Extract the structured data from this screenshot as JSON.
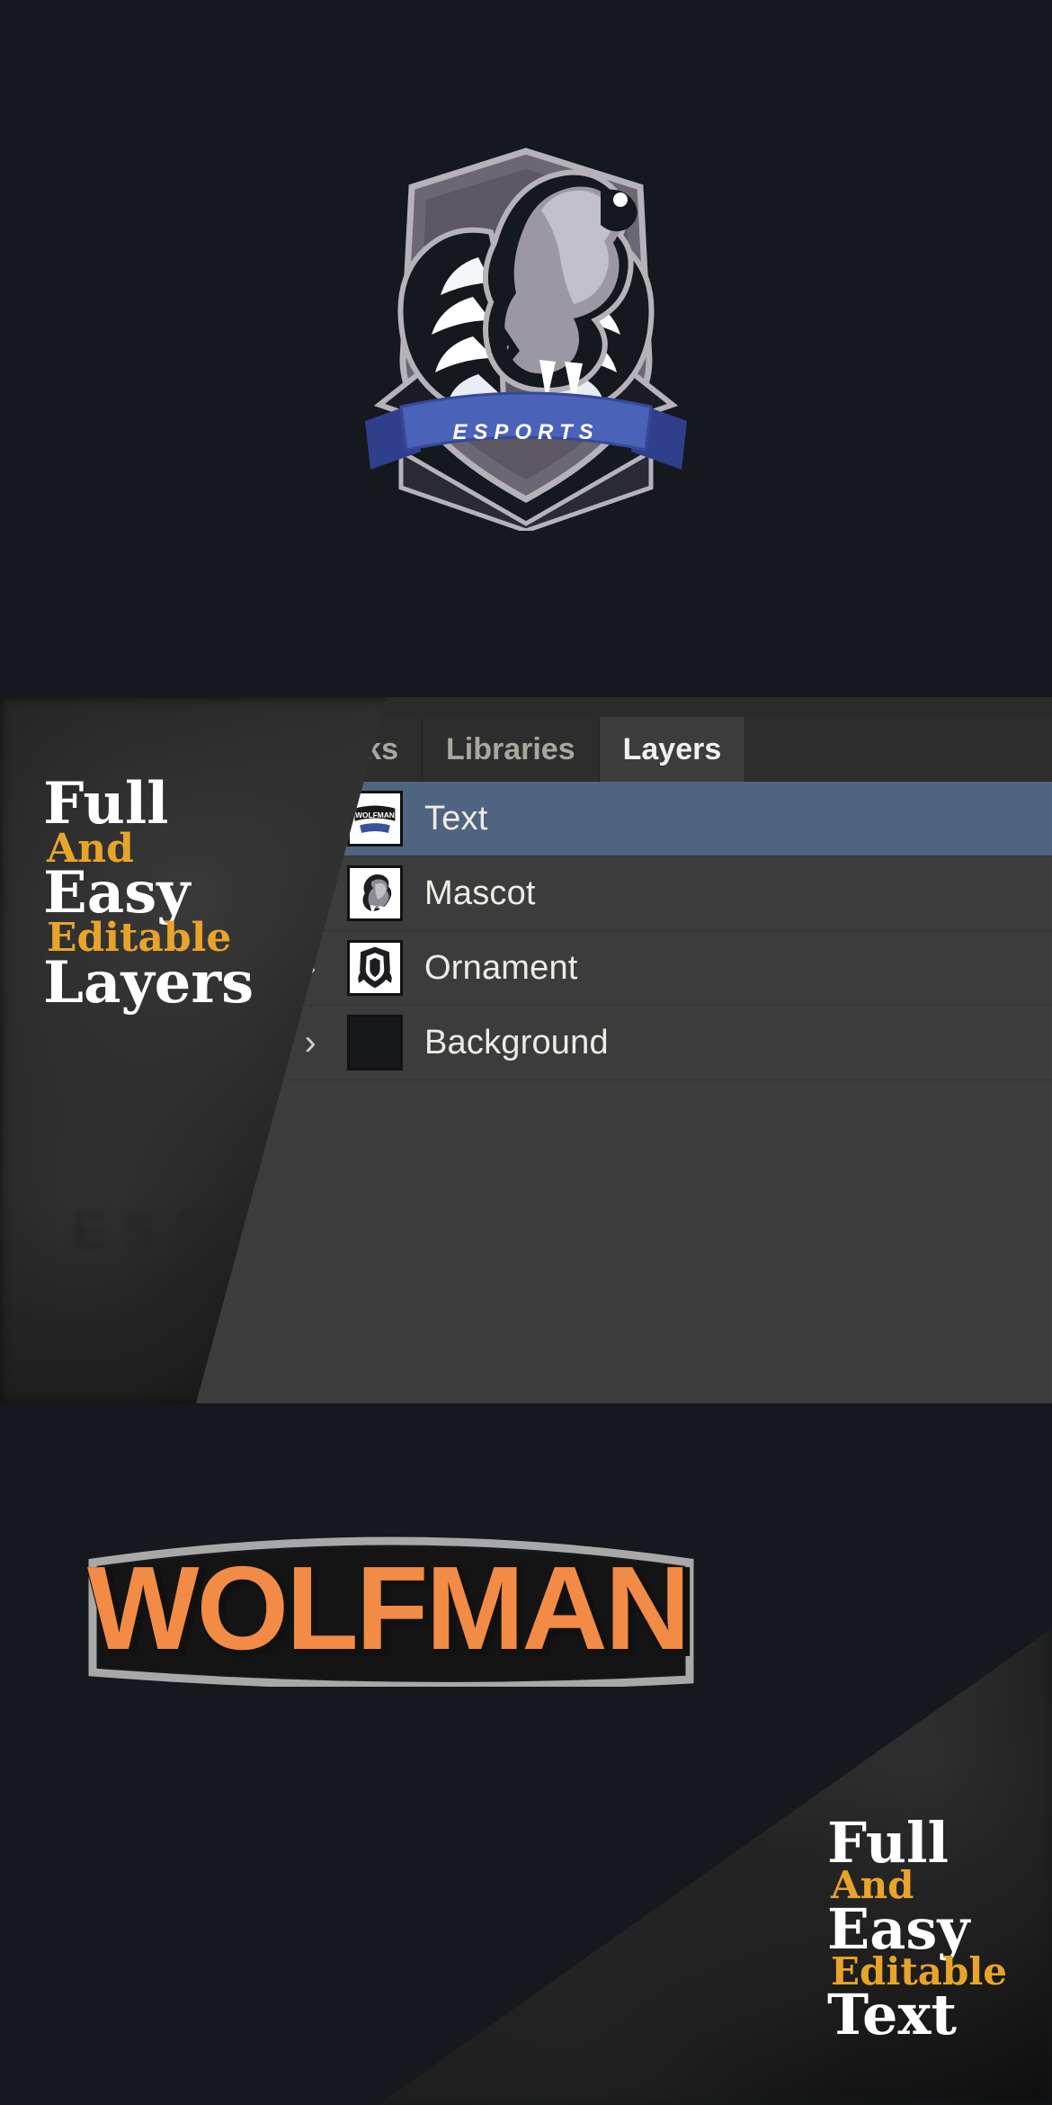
{
  "hero": {
    "logo": {
      "name": "wolfman-esports-logo",
      "banner_text": "ESPORTS",
      "banner_color": "#4a63b8",
      "shield_color": "#6b6773",
      "wing_color": "#ffffff",
      "wolf_color": "#9b98a4",
      "outline_color": "#b5b3b8",
      "background_color": "#15181c"
    }
  },
  "layers_section": {
    "headline": {
      "line1": "Full",
      "line2": "And",
      "line3": "Easy",
      "line4": "Editable",
      "line5": "Layers",
      "white_color": "#ffffff",
      "gold_color": "#e8a42a"
    },
    "panel": {
      "name": "photoshop-layers-panel",
      "background_color": "#3c3c3c",
      "tabs": [
        {
          "label": "nks",
          "active": false,
          "truncated": true
        },
        {
          "label": "Libraries",
          "active": false,
          "truncated": false
        },
        {
          "label": "Layers",
          "active": true,
          "truncated": false
        }
      ],
      "rows": [
        {
          "label": "Text",
          "selected": true,
          "has_chevron": false,
          "color_strip": null,
          "thumbnail": "wolfman-wordmark-thumb"
        },
        {
          "label": "Mascot",
          "selected": false,
          "has_chevron": true,
          "color_strip": null,
          "thumbnail": "wolf-head-thumb"
        },
        {
          "label": "Ornament",
          "selected": false,
          "has_chevron": true,
          "color_strip": "#f4f10a",
          "thumbnail": "shield-crest-thumb"
        },
        {
          "label": "Background",
          "selected": false,
          "has_chevron": true,
          "color_strip": "#3a36f0",
          "thumbnail": "solid-dark-thumb"
        }
      ],
      "selected_row_color": "#4e6480",
      "chevron_glyph": "›"
    },
    "ghost_watermark": "ESPORTS"
  },
  "wordmark_section": {
    "wordmark": {
      "name": "wolfman-wordmark",
      "text": "WOLFMAN",
      "fill_color": "#f28b45",
      "outline_color": "#a8a8a8",
      "shadow_color": "#111111"
    },
    "headline": {
      "line1": "Full",
      "line2": "And",
      "line3": "Easy",
      "line4": "Editable",
      "line5": "Text",
      "white_color": "#ffffff",
      "gold_color": "#e8a42a"
    }
  }
}
